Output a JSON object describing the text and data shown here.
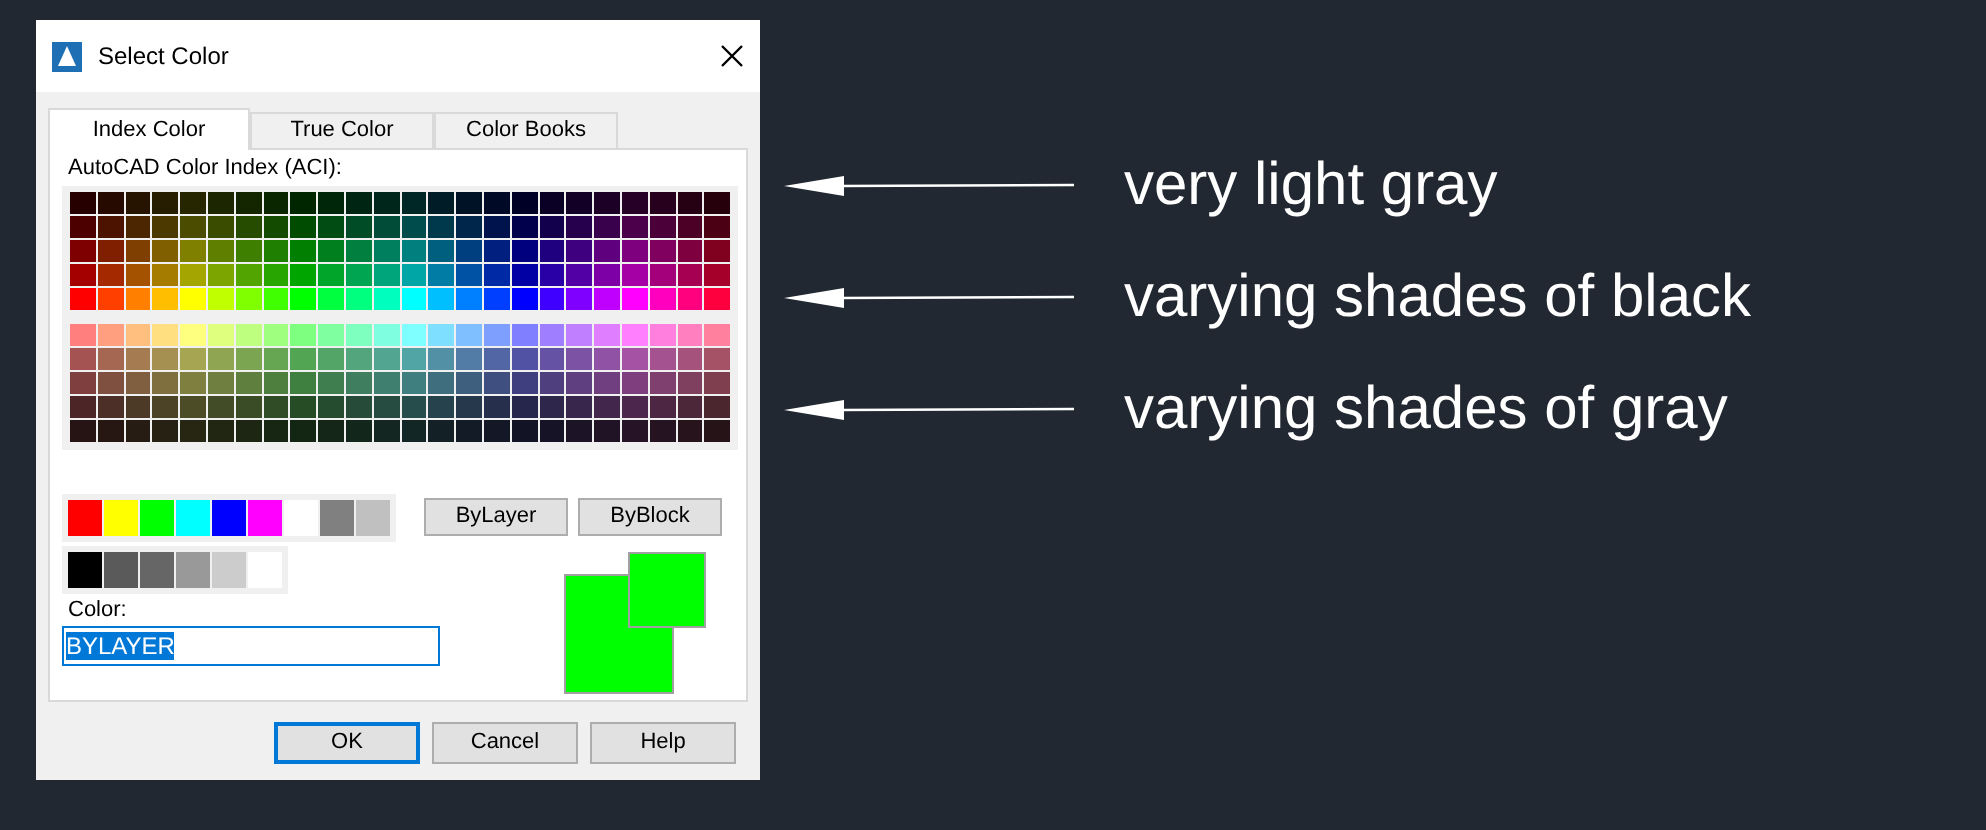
{
  "window": {
    "title": "Select Color"
  },
  "tabs": [
    {
      "label": "Index Color",
      "selected": true
    },
    {
      "label": "True Color",
      "selected": false
    },
    {
      "label": "Color Books",
      "selected": false
    }
  ],
  "palette": {
    "label": "AutoCAD Color Index (ACI):",
    "top_rows": [
      [
        {
          "color": "#260000"
        },
        {
          "color": "#260a00"
        },
        {
          "color": "#261300"
        },
        {
          "color": "#261c00"
        },
        {
          "color": "#262600"
        },
        {
          "color": "#1c2600"
        },
        {
          "color": "#132600"
        },
        {
          "color": "#0a2600"
        },
        {
          "color": "#002600"
        },
        {
          "color": "#00260a"
        },
        {
          "color": "#002613"
        },
        {
          "color": "#00261c"
        },
        {
          "color": "#002626"
        },
        {
          "color": "#001c26"
        },
        {
          "color": "#001326"
        },
        {
          "color": "#000a26"
        },
        {
          "color": "#000026"
        },
        {
          "color": "#0a0026"
        },
        {
          "color": "#130026"
        },
        {
          "color": "#1c0026"
        },
        {
          "color": "#260026"
        },
        {
          "color": "#26001c"
        },
        {
          "color": "#260013"
        },
        {
          "color": "#26000a"
        }
      ],
      [
        {
          "color": "#4c0000"
        },
        {
          "color": "#4c1300"
        },
        {
          "color": "#4c2600"
        },
        {
          "color": "#4c3900"
        },
        {
          "color": "#4c4c00"
        },
        {
          "color": "#394c00"
        },
        {
          "color": "#264c00"
        },
        {
          "color": "#134c00"
        },
        {
          "color": "#004c00"
        },
        {
          "color": "#004c13"
        },
        {
          "color": "#004c26"
        },
        {
          "color": "#004c39"
        },
        {
          "color": "#004c4c"
        },
        {
          "color": "#00394c"
        },
        {
          "color": "#00264c"
        },
        {
          "color": "#00134c"
        },
        {
          "color": "#00004c"
        },
        {
          "color": "#13004c"
        },
        {
          "color": "#26004c"
        },
        {
          "color": "#39004c"
        },
        {
          "color": "#4c004c"
        },
        {
          "color": "#4c0039"
        },
        {
          "color": "#4c0026"
        },
        {
          "color": "#4c0013"
        }
      ],
      [
        {
          "color": "#7f0000"
        },
        {
          "color": "#7f1f00"
        },
        {
          "color": "#7f3f00"
        },
        {
          "color": "#7f5f00"
        },
        {
          "color": "#7f7f00"
        },
        {
          "color": "#5f7f00"
        },
        {
          "color": "#3f7f00"
        },
        {
          "color": "#1f7f00"
        },
        {
          "color": "#007f00"
        },
        {
          "color": "#007f1f"
        },
        {
          "color": "#007f3f"
        },
        {
          "color": "#007f5f"
        },
        {
          "color": "#007f7f"
        },
        {
          "color": "#005f7f"
        },
        {
          "color": "#003f7f"
        },
        {
          "color": "#001f7f"
        },
        {
          "color": "#00007f"
        },
        {
          "color": "#1f007f"
        },
        {
          "color": "#3f007f"
        },
        {
          "color": "#5f007f"
        },
        {
          "color": "#7f007f"
        },
        {
          "color": "#7f005f"
        },
        {
          "color": "#7f003f"
        },
        {
          "color": "#7f001f"
        }
      ],
      [
        {
          "color": "#a50000"
        },
        {
          "color": "#a52900"
        },
        {
          "color": "#a55200"
        },
        {
          "color": "#a57c00"
        },
        {
          "color": "#a5a500"
        },
        {
          "color": "#7ca500"
        },
        {
          "color": "#52a500"
        },
        {
          "color": "#29a500"
        },
        {
          "color": "#00a500"
        },
        {
          "color": "#00a529"
        },
        {
          "color": "#00a552"
        },
        {
          "color": "#00a57c"
        },
        {
          "color": "#00a5a5"
        },
        {
          "color": "#007ca5"
        },
        {
          "color": "#0052a5"
        },
        {
          "color": "#0029a5"
        },
        {
          "color": "#0000a5"
        },
        {
          "color": "#2900a5"
        },
        {
          "color": "#5200a5"
        },
        {
          "color": "#7c00a5"
        },
        {
          "color": "#a500a5"
        },
        {
          "color": "#a5007c"
        },
        {
          "color": "#a50052"
        },
        {
          "color": "#a50029"
        }
      ],
      [
        {
          "color": "#ff0000"
        },
        {
          "color": "#ff3f00"
        },
        {
          "color": "#ff7f00"
        },
        {
          "color": "#ffbf00"
        },
        {
          "color": "#ffff00"
        },
        {
          "color": "#bfff00"
        },
        {
          "color": "#7fff00"
        },
        {
          "color": "#3fff00"
        },
        {
          "color": "#00ff00"
        },
        {
          "color": "#00ff3f"
        },
        {
          "color": "#00ff7f"
        },
        {
          "color": "#00ffbf"
        },
        {
          "color": "#00ffff"
        },
        {
          "color": "#00bfff"
        },
        {
          "color": "#007fff"
        },
        {
          "color": "#003fff"
        },
        {
          "color": "#0000ff"
        },
        {
          "color": "#3f00ff"
        },
        {
          "color": "#7f00ff"
        },
        {
          "color": "#bf00ff"
        },
        {
          "color": "#ff00ff"
        },
        {
          "color": "#ff00bf"
        },
        {
          "color": "#ff007f"
        },
        {
          "color": "#ff003f"
        }
      ]
    ],
    "bottom_rows": [
      [
        {
          "color": "#ff7f7f"
        },
        {
          "color": "#ff9f7f"
        },
        {
          "color": "#ffbf7f"
        },
        {
          "color": "#ffdf7f"
        },
        {
          "color": "#ffff7f"
        },
        {
          "color": "#dfff7f"
        },
        {
          "color": "#bfff7f"
        },
        {
          "color": "#9fff7f"
        },
        {
          "color": "#7fff7f"
        },
        {
          "color": "#7fff9f"
        },
        {
          "color": "#7fffbf"
        },
        {
          "color": "#7fffdf"
        },
        {
          "color": "#7fffff"
        },
        {
          "color": "#7fdfff"
        },
        {
          "color": "#7fbfff"
        },
        {
          "color": "#7f9fff"
        },
        {
          "color": "#7f7fff"
        },
        {
          "color": "#9f7fff"
        },
        {
          "color": "#bf7fff"
        },
        {
          "color": "#df7fff"
        },
        {
          "color": "#ff7fff"
        },
        {
          "color": "#ff7fdf"
        },
        {
          "color": "#ff7fbf"
        },
        {
          "color": "#ff7f9f"
        }
      ],
      [
        {
          "color": "#a55252"
        },
        {
          "color": "#a56652"
        },
        {
          "color": "#a57c52"
        },
        {
          "color": "#a59052"
        },
        {
          "color": "#a5a552"
        },
        {
          "color": "#90a552"
        },
        {
          "color": "#7ca552"
        },
        {
          "color": "#66a552"
        },
        {
          "color": "#52a552"
        },
        {
          "color": "#52a566"
        },
        {
          "color": "#52a57c"
        },
        {
          "color": "#52a590"
        },
        {
          "color": "#52a5a5"
        },
        {
          "color": "#5290a5"
        },
        {
          "color": "#527ca5"
        },
        {
          "color": "#5266a5"
        },
        {
          "color": "#5252a5"
        },
        {
          "color": "#6652a5"
        },
        {
          "color": "#7c52a5"
        },
        {
          "color": "#9052a5"
        },
        {
          "color": "#a552a5"
        },
        {
          "color": "#a55290"
        },
        {
          "color": "#a5527c"
        },
        {
          "color": "#a55266"
        }
      ],
      [
        {
          "color": "#7f3f3f"
        },
        {
          "color": "#7f4f3f"
        },
        {
          "color": "#7f5f3f"
        },
        {
          "color": "#7f6f3f"
        },
        {
          "color": "#7f7f3f"
        },
        {
          "color": "#6f7f3f"
        },
        {
          "color": "#5f7f3f"
        },
        {
          "color": "#4f7f3f"
        },
        {
          "color": "#3f7f3f"
        },
        {
          "color": "#3f7f4f"
        },
        {
          "color": "#3f7f5f"
        },
        {
          "color": "#3f7f6f"
        },
        {
          "color": "#3f7f7f"
        },
        {
          "color": "#3f6f7f"
        },
        {
          "color": "#3f5f7f"
        },
        {
          "color": "#3f4f7f"
        },
        {
          "color": "#3f3f7f"
        },
        {
          "color": "#4f3f7f"
        },
        {
          "color": "#5f3f7f"
        },
        {
          "color": "#6f3f7f"
        },
        {
          "color": "#7f3f7f"
        },
        {
          "color": "#7f3f6f"
        },
        {
          "color": "#7f3f5f"
        },
        {
          "color": "#7f3f4f"
        }
      ],
      [
        {
          "color": "#4c2626"
        },
        {
          "color": "#4c2f26"
        },
        {
          "color": "#4c3926"
        },
        {
          "color": "#4c4226"
        },
        {
          "color": "#4c4c26"
        },
        {
          "color": "#424c26"
        },
        {
          "color": "#394c26"
        },
        {
          "color": "#2f4c26"
        },
        {
          "color": "#264c26"
        },
        {
          "color": "#264c2f"
        },
        {
          "color": "#264c39"
        },
        {
          "color": "#264c42"
        },
        {
          "color": "#264c4c"
        },
        {
          "color": "#26424c"
        },
        {
          "color": "#26394c"
        },
        {
          "color": "#262f4c"
        },
        {
          "color": "#26264c"
        },
        {
          "color": "#2f264c"
        },
        {
          "color": "#39264c"
        },
        {
          "color": "#42264c"
        },
        {
          "color": "#4c264c"
        },
        {
          "color": "#4c2642"
        },
        {
          "color": "#4c2639"
        },
        {
          "color": "#4c262f"
        }
      ],
      [
        {
          "color": "#261313"
        },
        {
          "color": "#261713"
        },
        {
          "color": "#261c13"
        },
        {
          "color": "#262113"
        },
        {
          "color": "#262613"
        },
        {
          "color": "#212613"
        },
        {
          "color": "#1c2613"
        },
        {
          "color": "#172613"
        },
        {
          "color": "#132613"
        },
        {
          "color": "#132617"
        },
        {
          "color": "#13261c"
        },
        {
          "color": "#132621"
        },
        {
          "color": "#132626"
        },
        {
          "color": "#132126"
        },
        {
          "color": "#131c26"
        },
        {
          "color": "#131726"
        },
        {
          "color": "#131326"
        },
        {
          "color": "#171326"
        },
        {
          "color": "#1c1326"
        },
        {
          "color": "#211326"
        },
        {
          "color": "#261326"
        },
        {
          "color": "#261321"
        },
        {
          "color": "#26131c"
        },
        {
          "color": "#261317"
        }
      ]
    ]
  },
  "standard_colors": [
    {
      "color": "#ff0000"
    },
    {
      "color": "#ffff00"
    },
    {
      "color": "#00ff00"
    },
    {
      "color": "#00ffff"
    },
    {
      "color": "#0000ff"
    },
    {
      "color": "#ff00ff"
    },
    {
      "color": "#ffffff"
    },
    {
      "color": "#808080"
    },
    {
      "color": "#c0c0c0"
    }
  ],
  "gray_shades": [
    {
      "color": "#000000"
    },
    {
      "color": "#5a5a5a"
    },
    {
      "color": "#666666"
    },
    {
      "color": "#999999"
    },
    {
      "color": "#cccccc"
    },
    {
      "color": "#ffffff"
    }
  ],
  "by_buttons": [
    "ByLayer",
    "ByBlock"
  ],
  "color_field": {
    "label": "Color:",
    "value": "BYLAYER"
  },
  "preview": {
    "new": {
      "color": "#00ff00"
    },
    "old": {
      "color": "#00ff00"
    }
  },
  "buttons": [
    {
      "label": "OK",
      "default": true
    },
    {
      "label": "Cancel",
      "default": false
    },
    {
      "label": "Help",
      "default": false
    }
  ],
  "annotations": [
    "very light gray",
    "varying shades of black",
    "varying shades of gray"
  ]
}
